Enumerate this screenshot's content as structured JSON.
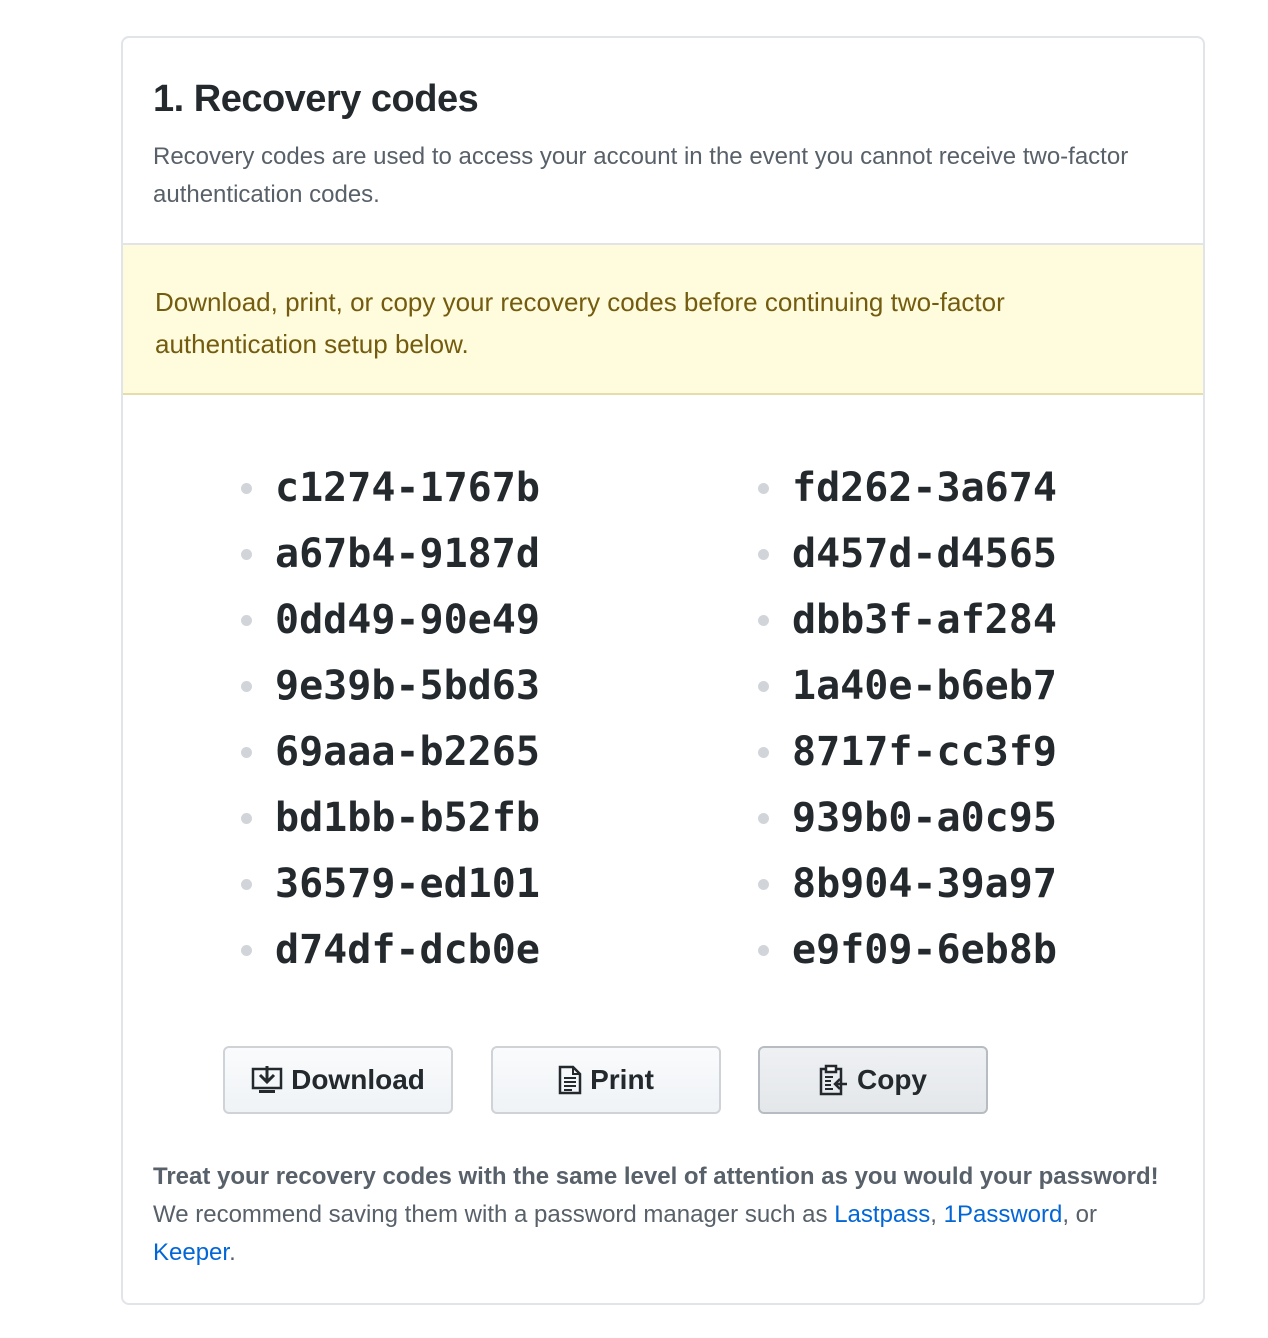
{
  "header": {
    "title": "1. Recovery codes",
    "description": "Recovery codes are used to access your account in the event you cannot receive two-factor authentication codes."
  },
  "warning": {
    "text": "Download, print, or copy your recovery codes before continuing two-factor authentication setup below."
  },
  "codes": {
    "left": [
      "c1274-1767b",
      "a67b4-9187d",
      "0dd49-90e49",
      "9e39b-5bd63",
      "69aaa-b2265",
      "bd1bb-b52fb",
      "36579-ed101",
      "d74df-dcb0e"
    ],
    "right": [
      "fd262-3a674",
      "d457d-d4565",
      "dbb3f-af284",
      "1a40e-b6eb7",
      "8717f-cc3f9",
      "939b0-a0c95",
      "8b904-39a97",
      "e9f09-6eb8b"
    ]
  },
  "buttons": {
    "download": {
      "label": "Download",
      "icon": "desktop-download-icon"
    },
    "print": {
      "label": "Print",
      "icon": "file-icon"
    },
    "copy": {
      "label": "Copy",
      "icon": "clippy-icon"
    }
  },
  "note": {
    "bold": "Treat your recovery codes with the same level of attention as you would your password!",
    "text": " We recommend saving them with a password manager such as ",
    "link1": "Lastpass",
    "sep1": ",",
    "link2": "1Password",
    "sep2": ", or ",
    "link3": "Keeper",
    "end": "."
  },
  "colors": {
    "link": "#0366d6",
    "warning_bg": "#fffbdd",
    "warning_text": "#735c0f",
    "border": "#e1e4e8"
  }
}
